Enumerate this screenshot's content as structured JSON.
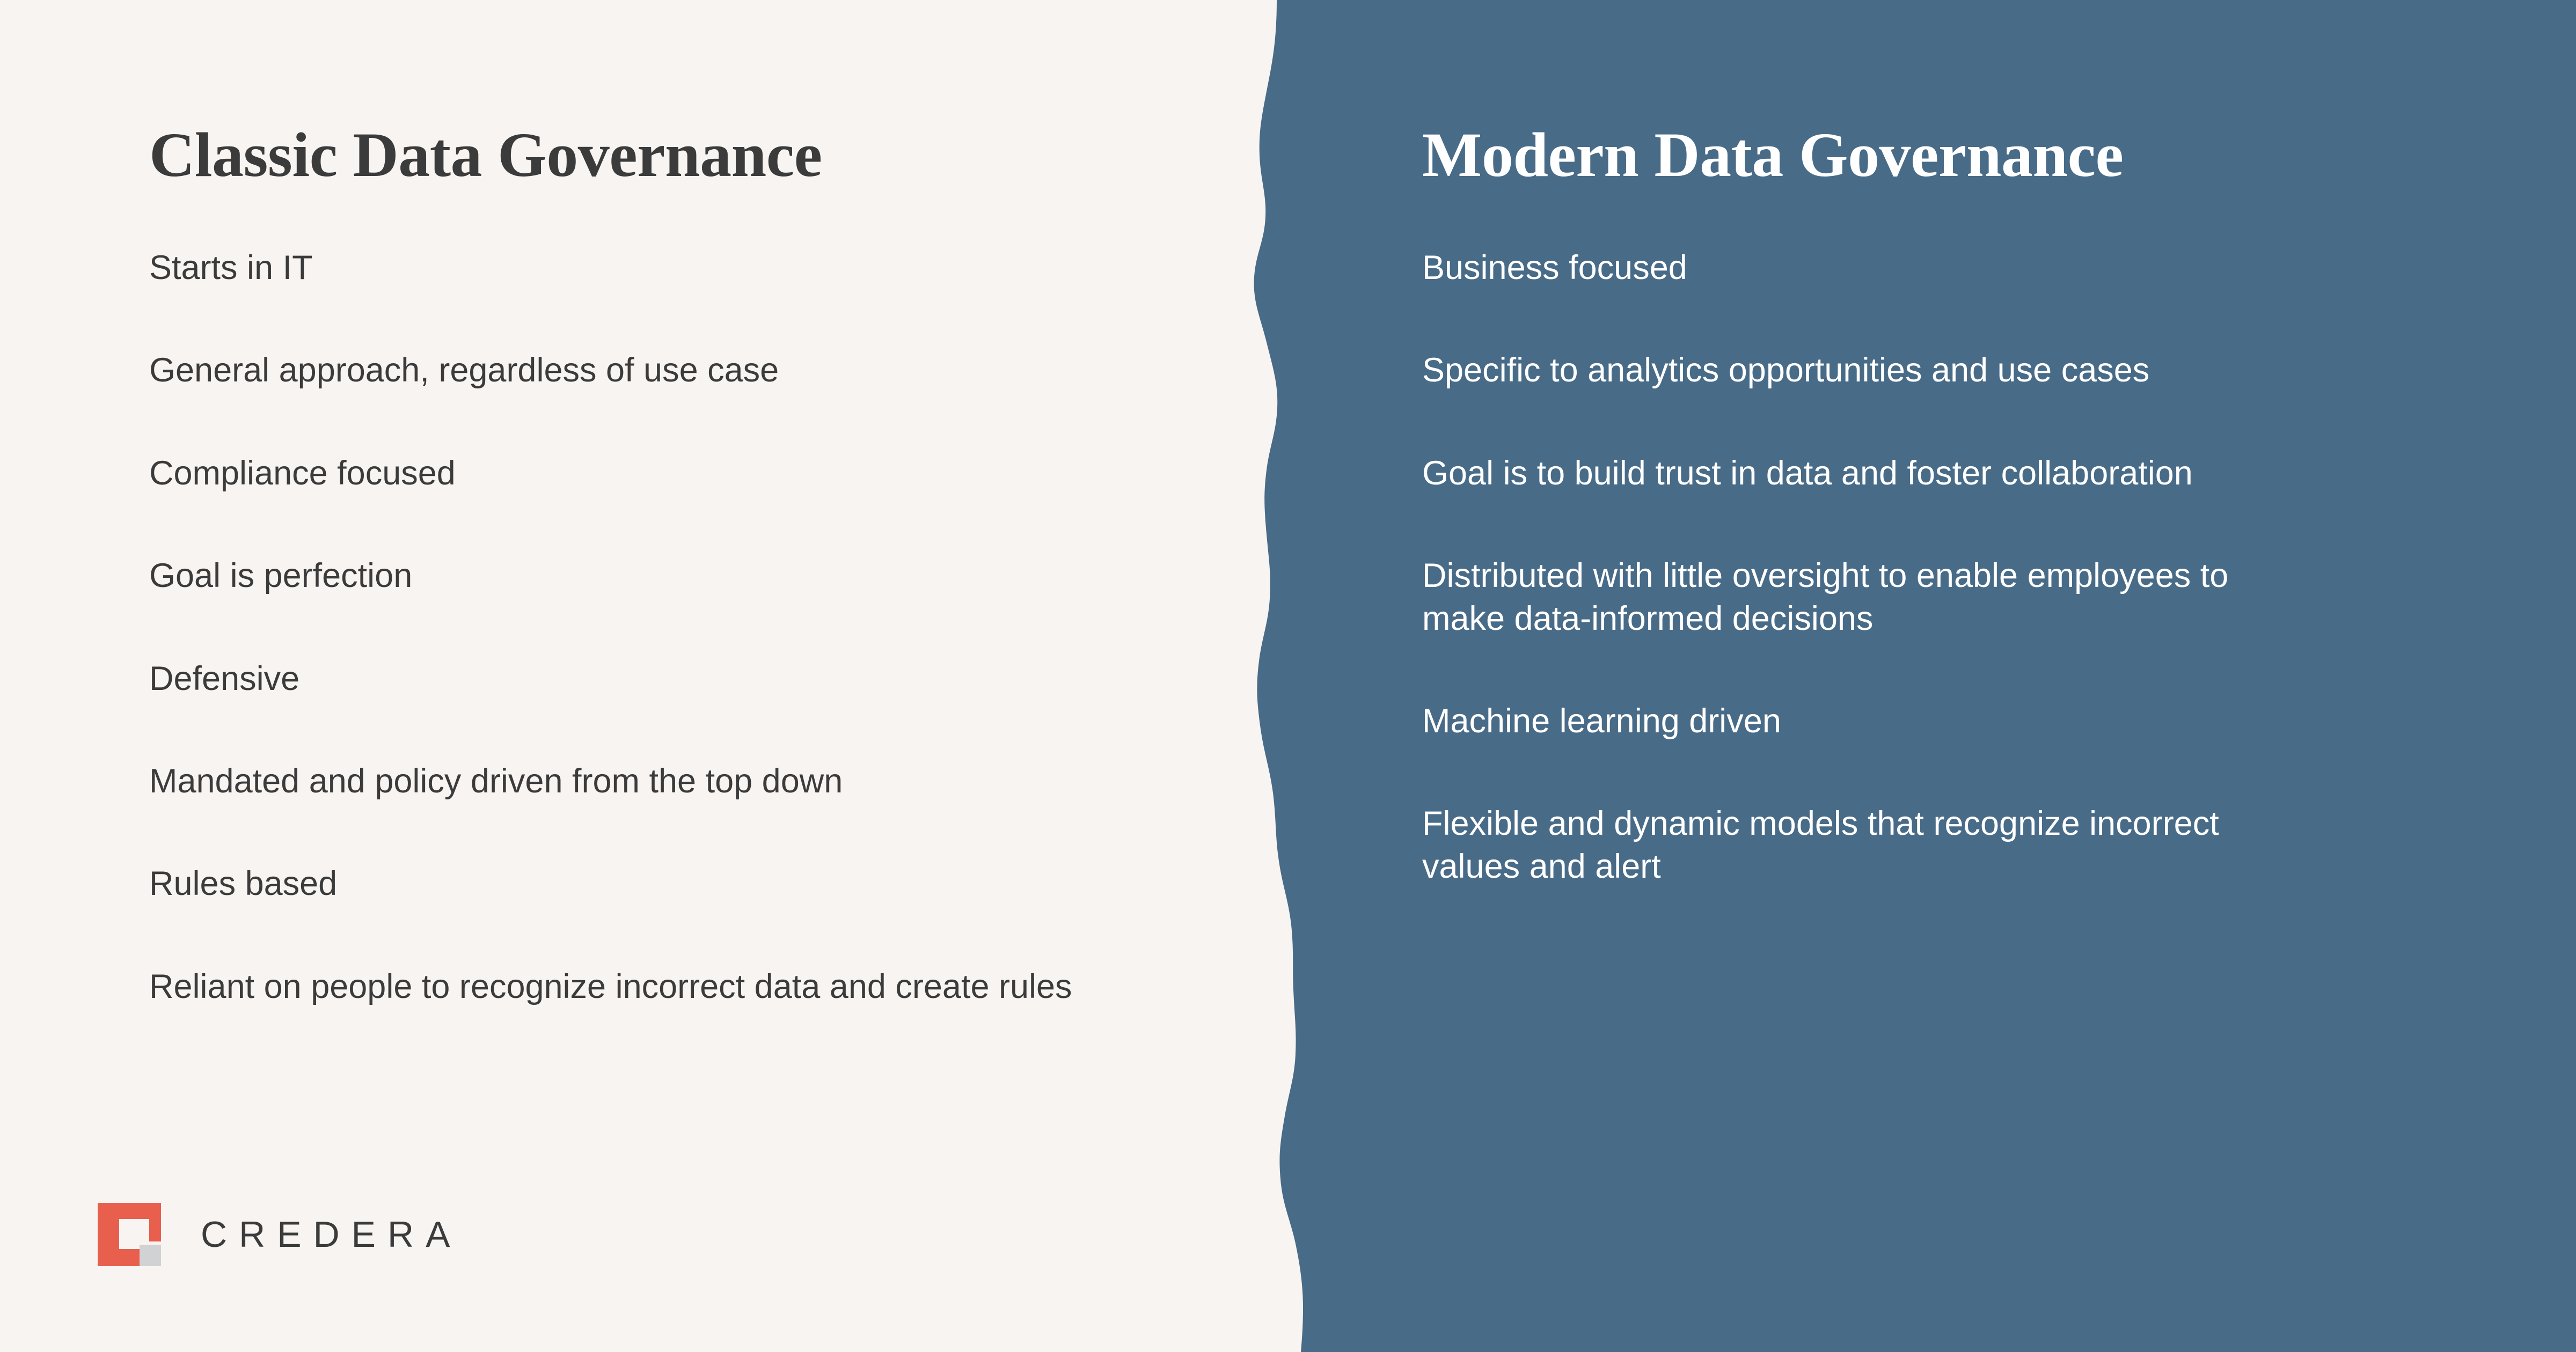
{
  "slide": {
    "background_color": "#F8F4F1",
    "accent_panel_color": "#486B88",
    "text_dark": "#3B3B3B",
    "text_light": "#FFFFFF"
  },
  "left_column": {
    "title": "Classic Data Governance",
    "items": [
      "Starts in IT",
      "General approach, regardless of use case",
      "Compliance focused",
      "Goal is perfection",
      "Defensive",
      "Mandated and policy driven from the top down",
      "Rules based",
      "Reliant on people to recognize incorrect data and create rules"
    ]
  },
  "right_column": {
    "title": "Modern Data Governance",
    "items": [
      "Business focused",
      "Specific to analytics opportunities and use cases",
      "Goal is to build trust in data and foster collaboration",
      "Distributed with little oversight to enable employees to make data-informed decisions",
      "Machine learning driven",
      "Flexible and dynamic models that recognize incorrect values and alert"
    ]
  },
  "logo": {
    "wordmark": "CREDERA",
    "mark_color": "#E85F4D",
    "square_color": "#D0D2D3"
  }
}
